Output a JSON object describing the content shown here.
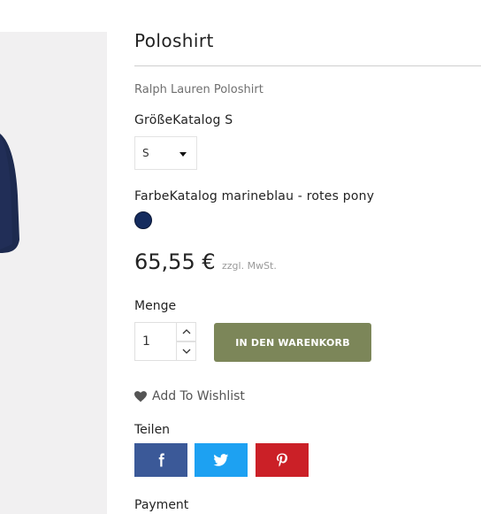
{
  "product": {
    "title": "Poloshirt",
    "brand_line": "Ralph Lauren Poloshirt"
  },
  "size": {
    "label": "GrößeKatalog S",
    "selected": "S"
  },
  "color": {
    "label": "FarbeKatalog marineblau - rotes pony",
    "swatch_color": "#142b5e"
  },
  "price": {
    "amount": "65,55 €",
    "tax_note": "zzgl. MwSt."
  },
  "quantity": {
    "label": "Menge",
    "value": "1"
  },
  "cart": {
    "add_label": "IN DEN WARENKORB",
    "button_color": "#7c8659"
  },
  "wishlist": {
    "label": "Add To Wishlist",
    "icon": "heart-icon"
  },
  "share": {
    "label": "Teilen",
    "networks": [
      {
        "name": "facebook",
        "icon": "facebook-icon",
        "color": "#3b5998"
      },
      {
        "name": "twitter",
        "icon": "twitter-icon",
        "color": "#1da1f2"
      },
      {
        "name": "pinterest",
        "icon": "pinterest-icon",
        "color": "#cb2027"
      }
    ]
  },
  "payment": {
    "label": "Payment"
  }
}
